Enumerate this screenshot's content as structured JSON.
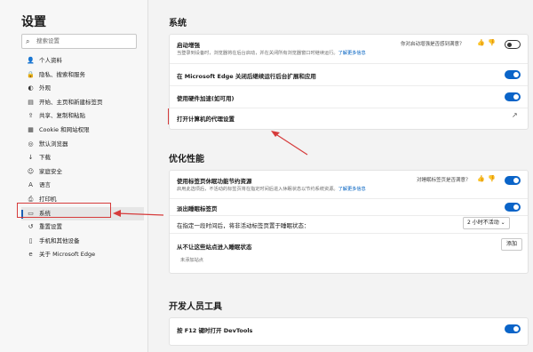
{
  "sidebar": {
    "title": "设置",
    "search_placeholder": "搜索设置",
    "items": [
      {
        "icon": "👤",
        "label": "个人资料"
      },
      {
        "icon": "🔒",
        "label": "隐私、搜索和服务"
      },
      {
        "icon": "◐",
        "label": "外观"
      },
      {
        "icon": "▤",
        "label": "开始、主页和新建标签页"
      },
      {
        "icon": "⇪",
        "label": "共享、复制和粘贴"
      },
      {
        "icon": "▦",
        "label": "Cookie 和网站权限"
      },
      {
        "icon": "◎",
        "label": "默认浏览器"
      },
      {
        "icon": "↓",
        "label": "下载"
      },
      {
        "icon": "☺",
        "label": "家庭安全"
      },
      {
        "icon": "A",
        "label": "语言"
      },
      {
        "icon": "⎙",
        "label": "打印机"
      },
      {
        "icon": "▭",
        "label": "系统"
      },
      {
        "icon": "↺",
        "label": "重置设置"
      },
      {
        "icon": "▯",
        "label": "手机和其他设备"
      },
      {
        "icon": "e",
        "label": "关于 Microsoft Edge"
      }
    ]
  },
  "system": {
    "title": "系统",
    "startup_boost": {
      "label": "启动增强",
      "desc": "当登录到设备时，浏览器将在后台启动，并在关闭所有浏览器窗口时继续运行。",
      "link": "了解更多信息",
      "feedback_q": "你对启动增强是否感到满意？",
      "thumb_up": "👍",
      "thumb_down": "👎",
      "enabled": false
    },
    "background_apps": {
      "label": "在 Microsoft Edge 关闭后继续运行后台扩展和应用",
      "enabled": true
    },
    "hardware_accel": {
      "label": "使用硬件加速(如可用)",
      "enabled": true
    },
    "proxy": {
      "label": "打开计算机的代理设置",
      "icon": "↗"
    }
  },
  "performance": {
    "title": "优化性能",
    "sleeping_tabs": {
      "label": "使用标签页休眠功能节约资源",
      "desc1": "启用此选项后，不活动的标签页将在指定时间后进入休眠状态以节约系统资源。",
      "link": "了解更多信息",
      "feedback_q": "对睡眠标签页是否满意？",
      "enabled": true
    },
    "fade_sleeping": {
      "label": "淡出睡眠标签页",
      "enabled": true
    },
    "sleep_after": {
      "label": "在指定一段时间后，将非活动标签页置于睡眠状态：",
      "value": "2 小时不活动"
    },
    "never_sleep": {
      "label": "从不让这些站点进入睡眠状态",
      "add_button": "添加",
      "empty": "未添加站点"
    }
  },
  "devtools": {
    "title": "开发人员工具",
    "f12": {
      "label": "按 F12 键时打开 DevTools",
      "enabled": true
    }
  },
  "colors": {
    "accent": "#0a64c8",
    "annotation": "#d63b3b"
  }
}
